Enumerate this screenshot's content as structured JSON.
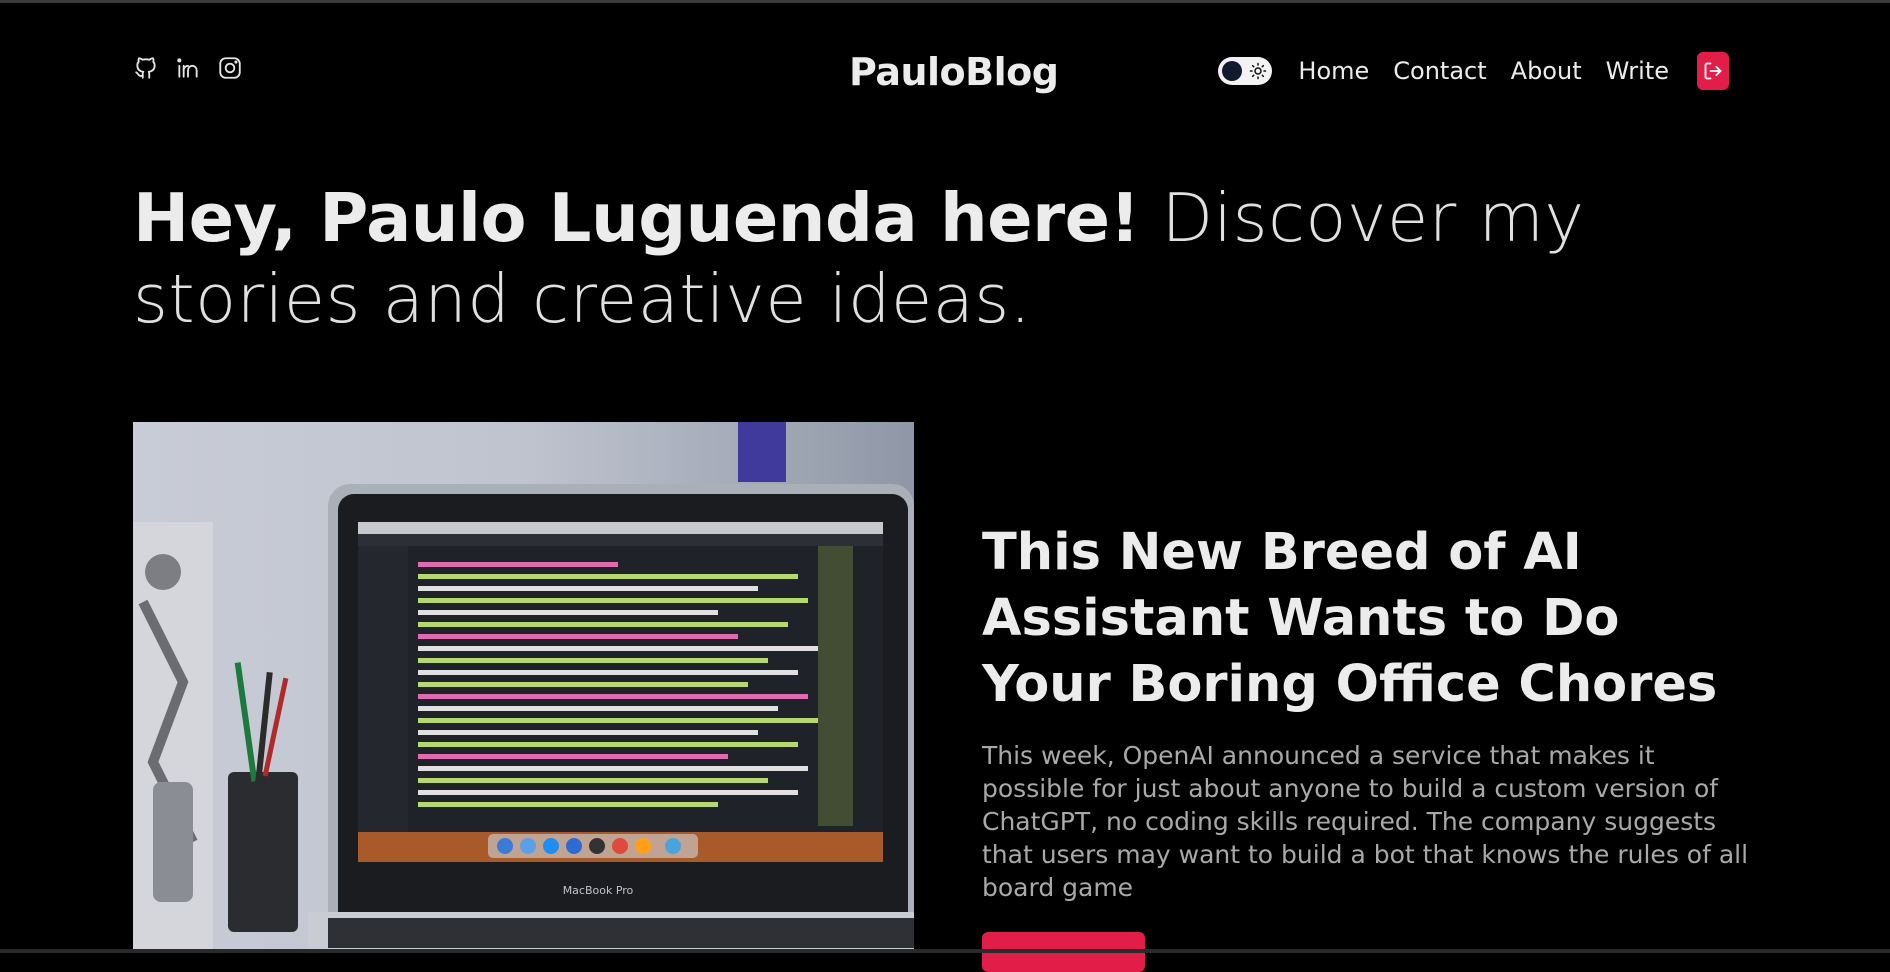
{
  "header": {
    "logo": "PauloBlog",
    "social": [
      "github-icon",
      "linkedin-icon",
      "instagram-icon"
    ],
    "nav": {
      "home": "Home",
      "contact": "Contact",
      "about": "About",
      "write": "Write"
    }
  },
  "hero": {
    "bold": "Hey, Paulo Luguenda here!",
    "light": " Discover my stories and creative ideas."
  },
  "featured": {
    "title": "This New Breed of AI Assistant Wants to Do Your Boring Office Chores",
    "description": "This week, OpenAI announced a service that makes it possible for just about anyone to build a custom version of ChatGPT, no coding skills required. The company suggests that users may want to build a bot that knows the rules of all board game",
    "image_caption": "MacBook Pro"
  },
  "colors": {
    "accent": "#e11d48",
    "background": "#000000",
    "text": "#ececec",
    "muted": "#a9a9a9"
  }
}
